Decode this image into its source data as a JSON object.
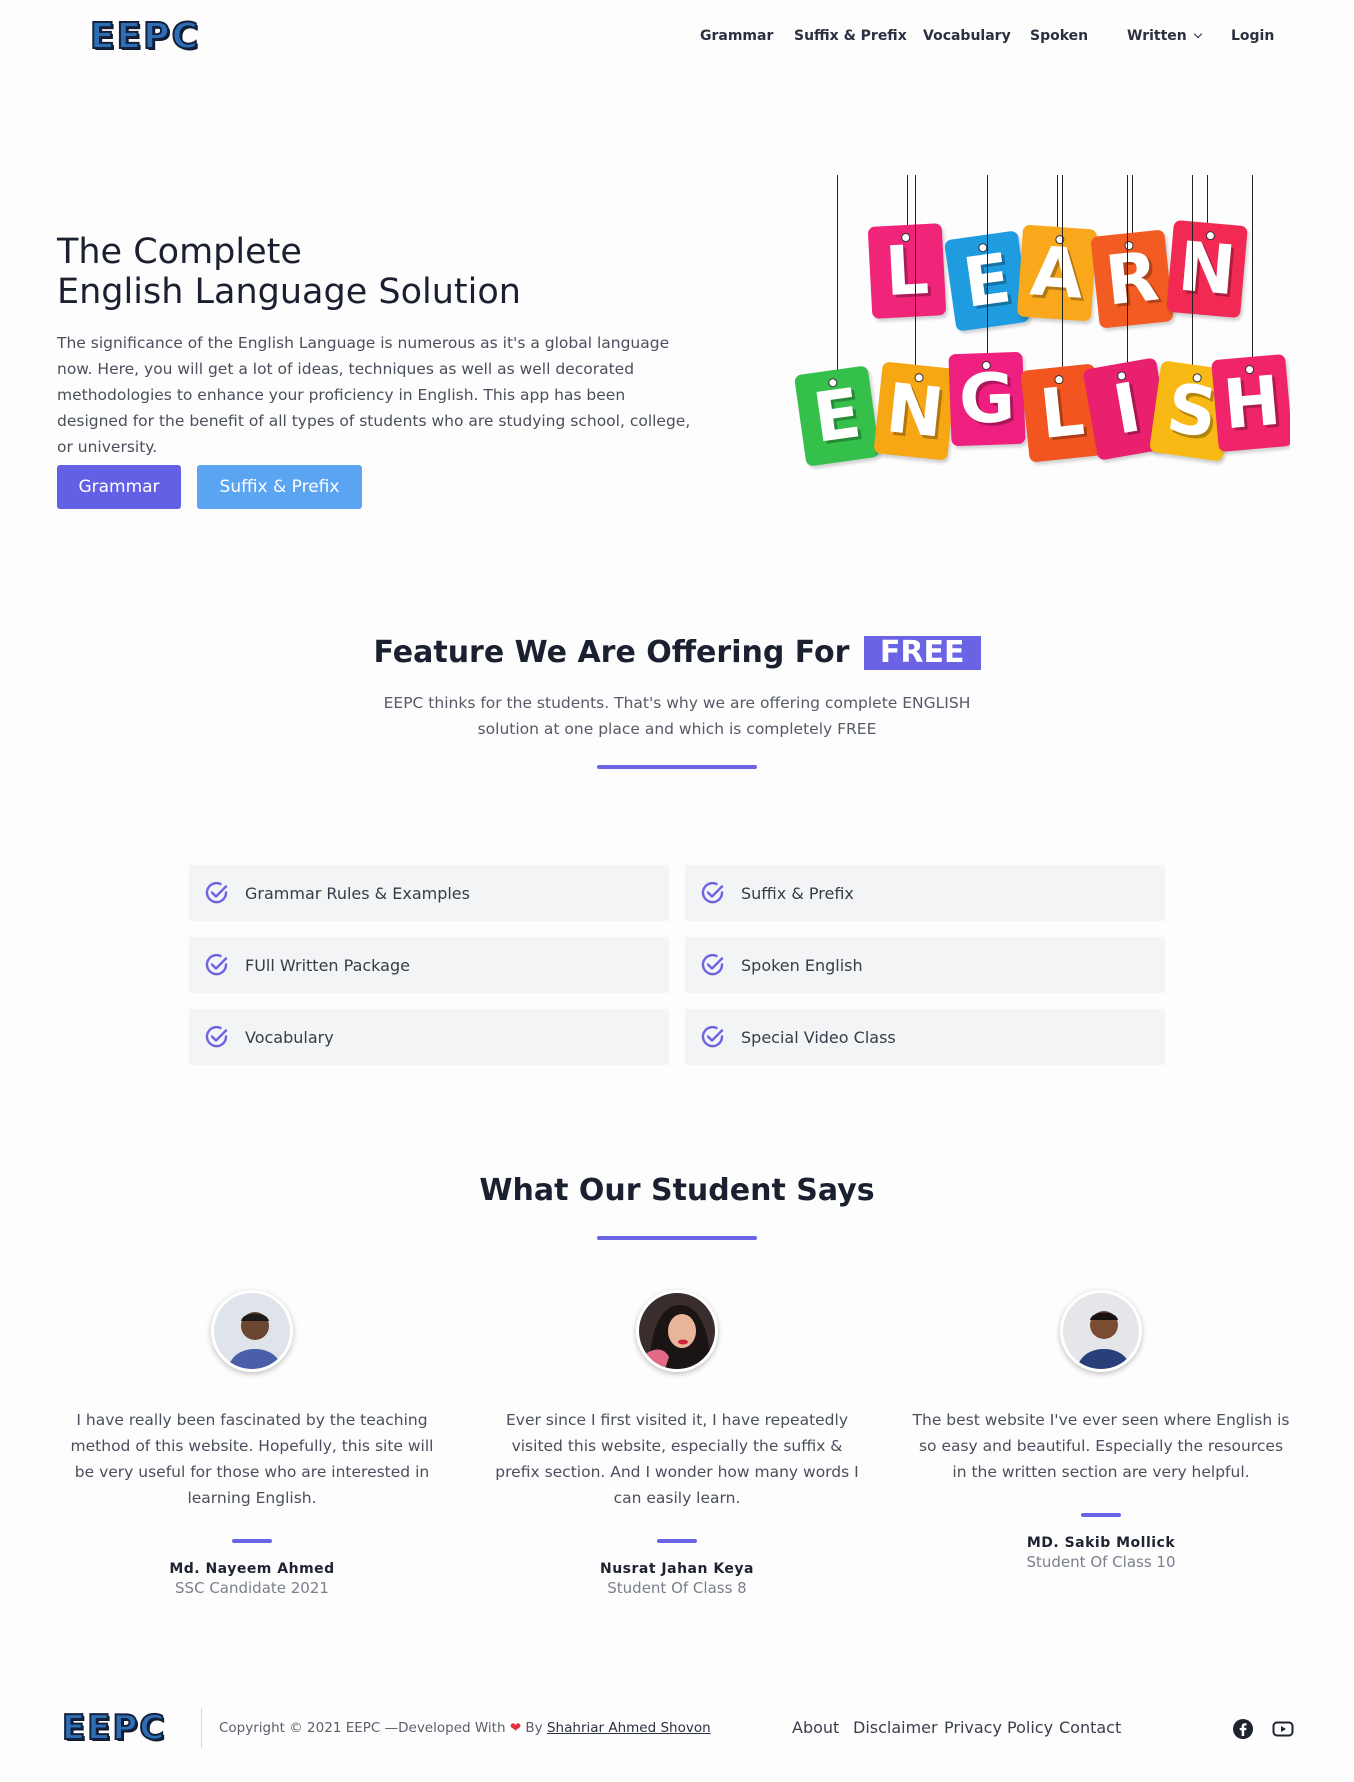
{
  "header": {
    "logo": "EEPC",
    "nav": [
      {
        "label": "Grammar"
      },
      {
        "label": "Suffix & Prefix"
      },
      {
        "label": "Vocabulary"
      },
      {
        "label": "Spoken"
      },
      {
        "label": "Written"
      },
      {
        "label": "Login"
      }
    ]
  },
  "hero": {
    "title_line1": "The Complete",
    "title_line2": "English Language Solution",
    "description": "The significance of the English Language is numerous as it's a global language now. Here, you will get a lot of ideas, techniques as well as well decorated methodologies to enhance your proficiency in English. This app has been designed for the benefit of all types of students who are studying school, college, or university.",
    "btn_grammar": "Grammar",
    "btn_suffix": "Suffix & Prefix",
    "image_word1": [
      "L",
      "E",
      "A",
      "R",
      "N"
    ],
    "image_word2": [
      "E",
      "N",
      "G",
      "L",
      "I",
      "S",
      "H"
    ]
  },
  "features": {
    "heading": "Feature We Are Offering For",
    "badge": "FREE",
    "subtitle": "EEPC thinks for the students. That's why we are offering complete ENGLISH solution at one place and which is completely FREE",
    "items": [
      {
        "label": "Grammar Rules & Examples"
      },
      {
        "label": "Suffix & Prefix"
      },
      {
        "label": "FUll Written Package"
      },
      {
        "label": "Spoken English"
      },
      {
        "label": "Vocabulary"
      },
      {
        "label": "Special Video Class"
      }
    ]
  },
  "testimonials": {
    "heading": "What Our Student Says",
    "items": [
      {
        "quote": "I have really been fascinated by the teaching method of this website. Hopefully, this site will be very useful for those who are interested in learning English.",
        "name": "Md. Nayeem Ahmed",
        "role": "SSC Candidate 2021"
      },
      {
        "quote": "Ever since I first visited it, I have repeatedly visited this website, especially the suffix & prefix section. And I wonder how many words I can easily learn.",
        "name": "Nusrat Jahan Keya",
        "role": "Student Of Class 8"
      },
      {
        "quote": "The best website I've ever seen where English is so easy and beautiful. Especially the resources in the written section are very helpful.",
        "name": "MD. Sakib Mollick",
        "role": "Student Of Class 10"
      }
    ]
  },
  "footer": {
    "logo": "EEPC",
    "copyright": "Copyright © 2021 EEPC —Developed With",
    "by": "By",
    "author": "Shahriar Ahmed Shovon",
    "links": [
      {
        "label": "About"
      },
      {
        "label": "Disclaimer"
      },
      {
        "label": "Privacy Policy"
      },
      {
        "label": "Contact"
      }
    ],
    "social_icons": [
      "facebook-icon",
      "youtube-icon"
    ]
  },
  "colors": {
    "accent": "#6a63e4",
    "button_secondary": "#5aa4f2",
    "card_bg": "#f3f4f6"
  }
}
